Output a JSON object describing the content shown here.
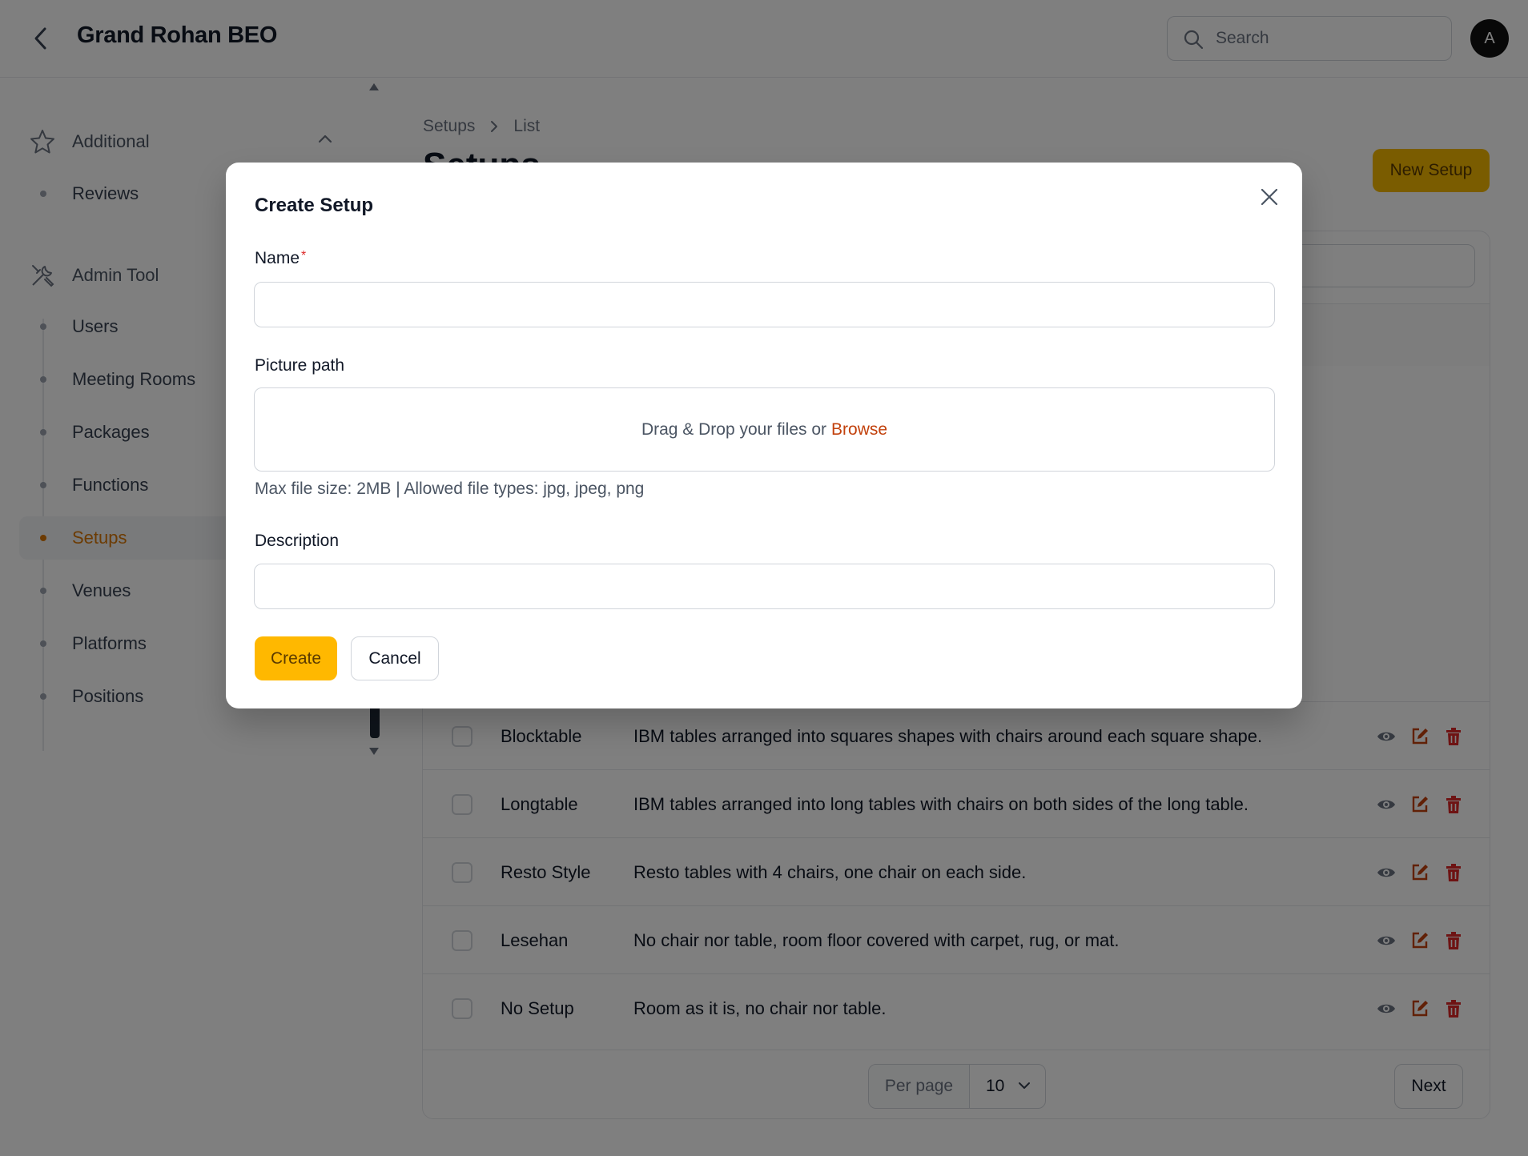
{
  "header": {
    "title": "Grand Rohan BEO",
    "search_placeholder": "Search",
    "avatar_initial": "A"
  },
  "sidebar": {
    "groups": [
      {
        "label": "Additional",
        "icon": "star-icon",
        "items": [
          {
            "label": "Reviews"
          }
        ]
      },
      {
        "label": "Admin Tool",
        "icon": "tools-icon",
        "items": [
          {
            "label": "Users"
          },
          {
            "label": "Meeting Rooms"
          },
          {
            "label": "Packages"
          },
          {
            "label": "Functions"
          },
          {
            "label": "Setups",
            "active": true
          },
          {
            "label": "Venues"
          },
          {
            "label": "Platforms"
          },
          {
            "label": "Positions"
          }
        ]
      }
    ]
  },
  "main": {
    "breadcrumb": [
      "Setups",
      "List"
    ],
    "title": "Setups",
    "new_button": "New Setup",
    "rows": [
      {
        "name": "Blocktable",
        "description": "IBM tables arranged into squares shapes with chairs around each square shape."
      },
      {
        "name": "Longtable",
        "description": "IBM tables arranged into long tables with chairs on both sides of the long table."
      },
      {
        "name": "Resto Style",
        "description": "Resto tables with 4 chairs, one chair on each side."
      },
      {
        "name": "Lesehan",
        "description": "No chair nor table, room floor covered with carpet, rug, or mat."
      },
      {
        "name": "No Setup",
        "description": "Room as it is, no chair nor table."
      }
    ],
    "pagination": {
      "per_page_label": "Per page",
      "per_page_value": "10",
      "next_label": "Next"
    }
  },
  "modal": {
    "title": "Create Setup",
    "name_label": "Name",
    "required_mark": "*",
    "picture_label": "Picture path",
    "dropzone_text": "Drag & Drop your files or",
    "browse_label": "Browse",
    "hint": "Max file size: 2MB | Allowed file types: jpg, jpeg, png",
    "description_label": "Description",
    "create_label": "Create",
    "cancel_label": "Cancel"
  },
  "colors": {
    "accent": "#ffb800",
    "active_nav": "#d97706",
    "browse_link": "#c2410c",
    "delete_icon": "#dc2626",
    "edit_icon": "#c2410c",
    "view_icon": "#6b7280"
  }
}
